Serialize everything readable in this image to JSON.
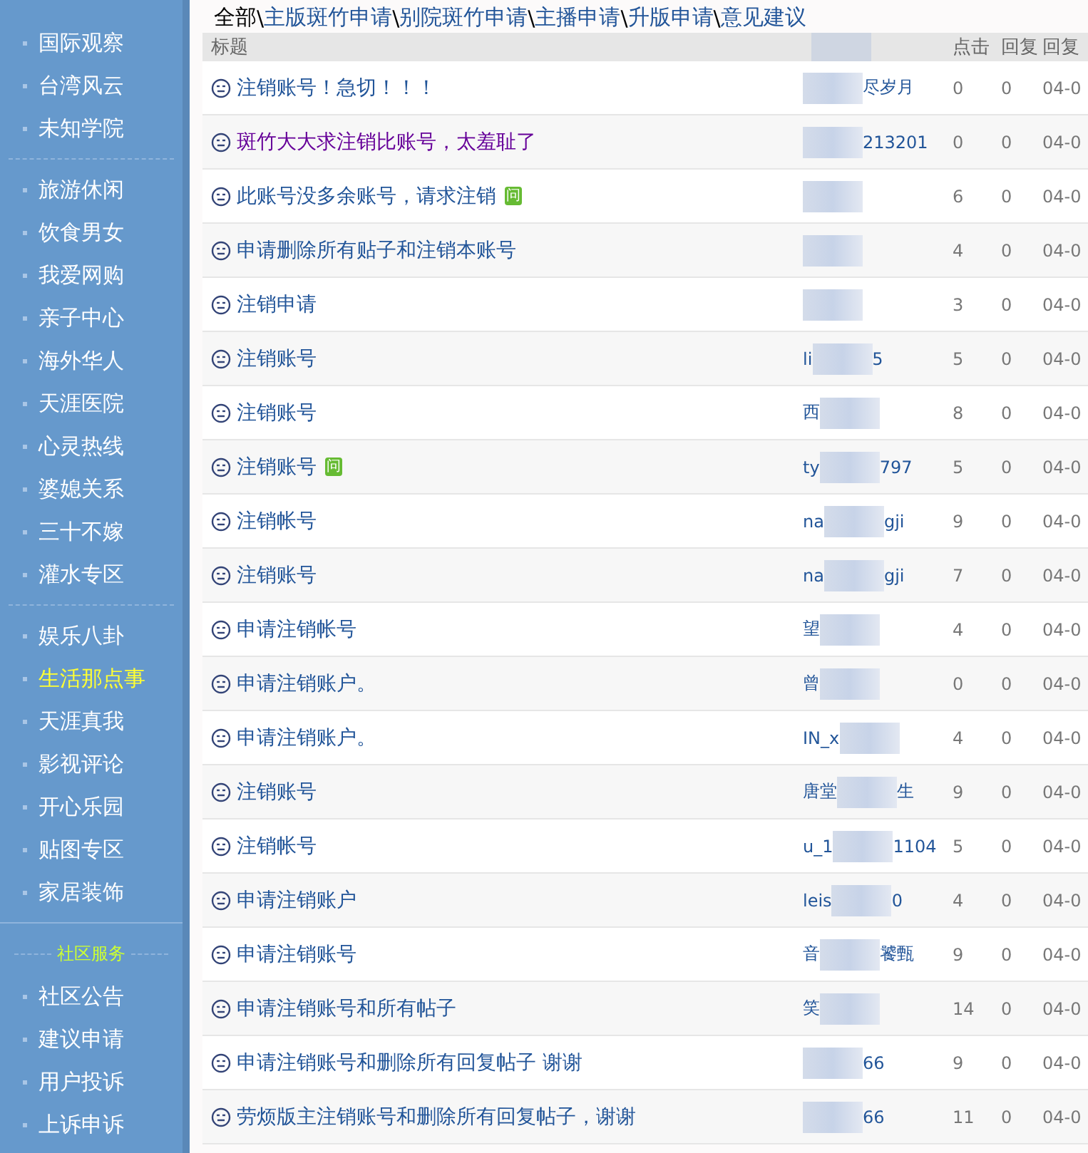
{
  "sidebar": {
    "groups": [
      {
        "kind": "links",
        "items": [
          {
            "label": "国际观察",
            "selected": false
          },
          {
            "label": "台湾风云",
            "selected": false
          },
          {
            "label": "未知学院",
            "selected": false
          }
        ]
      },
      {
        "kind": "links",
        "items": [
          {
            "label": "旅游休闲",
            "selected": false
          },
          {
            "label": "饮食男女",
            "selected": false
          },
          {
            "label": "我爱网购",
            "selected": false
          },
          {
            "label": "亲子中心",
            "selected": false
          },
          {
            "label": "海外华人",
            "selected": false
          },
          {
            "label": "天涯医院",
            "selected": false
          },
          {
            "label": "心灵热线",
            "selected": false
          },
          {
            "label": "婆媳关系",
            "selected": false
          },
          {
            "label": "三十不嫁",
            "selected": false
          },
          {
            "label": "灌水专区",
            "selected": false
          }
        ]
      },
      {
        "kind": "links",
        "items": [
          {
            "label": "娱乐八卦",
            "selected": false
          },
          {
            "label": "生活那点事",
            "selected": true
          },
          {
            "label": "天涯真我",
            "selected": false
          },
          {
            "label": "影视评论",
            "selected": false
          },
          {
            "label": "开心乐园",
            "selected": false
          },
          {
            "label": "贴图专区",
            "selected": false
          },
          {
            "label": "家居装饰",
            "selected": false
          }
        ]
      },
      {
        "kind": "section",
        "title": "社区服务",
        "items": [
          {
            "label": "社区公告",
            "selected": false
          },
          {
            "label": "建议申请",
            "selected": false
          },
          {
            "label": "用户投诉",
            "selected": false
          },
          {
            "label": "上诉申诉",
            "selected": false
          }
        ]
      }
    ]
  },
  "breadcrumb": {
    "separator": "\\",
    "items": [
      {
        "label": "全部",
        "selected": true
      },
      {
        "label": "主版斑竹申请",
        "selected": false
      },
      {
        "label": "别院斑竹申请",
        "selected": false
      },
      {
        "label": "主播申请",
        "selected": false
      },
      {
        "label": "升版申请",
        "selected": false
      },
      {
        "label": "意见建议",
        "selected": false
      }
    ]
  },
  "table": {
    "columns": [
      {
        "label": "标题"
      },
      {
        "kind": "blurred"
      },
      {
        "label": "点击"
      },
      {
        "label": "回复"
      },
      {
        "label": "回复"
      }
    ],
    "rows": [
      {
        "title": "注销账号！急切！！！",
        "visited": false,
        "badge": "",
        "author_start": "",
        "author_end": "尽岁月",
        "clicks": "0",
        "replies": "0",
        "date": "04-0"
      },
      {
        "title": "斑竹大大求注销比账号，太羞耻了",
        "visited": true,
        "badge": "",
        "author_start": "",
        "author_end": "213201",
        "clicks": "0",
        "replies": "0",
        "date": "04-0"
      },
      {
        "title": "此账号没多余账号，请求注销",
        "visited": false,
        "badge": "问",
        "author_start": "",
        "author_end": "",
        "clicks": "6",
        "replies": "0",
        "date": "04-0"
      },
      {
        "title": "申请删除所有贴子和注销本账号",
        "visited": false,
        "badge": "",
        "author_start": "",
        "author_end": "",
        "clicks": "4",
        "replies": "0",
        "date": "04-0"
      },
      {
        "title": "注销申请",
        "visited": false,
        "badge": "",
        "author_start": "",
        "author_end": "",
        "clicks": "3",
        "replies": "0",
        "date": "04-0"
      },
      {
        "title": "注销账号",
        "visited": false,
        "badge": "",
        "author_start": "li",
        "author_end": "5",
        "clicks": "5",
        "replies": "0",
        "date": "04-0"
      },
      {
        "title": "注销账号",
        "visited": false,
        "badge": "",
        "author_start": "西",
        "author_end": "",
        "clicks": "8",
        "replies": "0",
        "date": "04-0"
      },
      {
        "title": "注销账号",
        "visited": false,
        "badge": "问",
        "author_start": "ty",
        "author_end": "797",
        "clicks": "5",
        "replies": "0",
        "date": "04-0"
      },
      {
        "title": "注销帐号",
        "visited": false,
        "badge": "",
        "author_start": "na",
        "author_end": "gji",
        "clicks": "9",
        "replies": "0",
        "date": "04-0"
      },
      {
        "title": "注销账号",
        "visited": false,
        "badge": "",
        "author_start": "na",
        "author_end": "gji",
        "clicks": "7",
        "replies": "0",
        "date": "04-0"
      },
      {
        "title": "申请注销帐号",
        "visited": false,
        "badge": "",
        "author_start": "望",
        "author_end": "",
        "clicks": "4",
        "replies": "0",
        "date": "04-0"
      },
      {
        "title": "申请注销账户。",
        "visited": false,
        "badge": "",
        "author_start": "曾",
        "author_end": "",
        "clicks": "0",
        "replies": "0",
        "date": "04-0"
      },
      {
        "title": "申请注销账户。",
        "visited": false,
        "badge": "",
        "author_start": "IN_x",
        "author_end": "",
        "clicks": "4",
        "replies": "0",
        "date": "04-0"
      },
      {
        "title": "注销账号",
        "visited": false,
        "badge": "",
        "author_start": "唐堂",
        "author_end": "生",
        "clicks": "9",
        "replies": "0",
        "date": "04-0"
      },
      {
        "title": "注销帐号",
        "visited": false,
        "badge": "",
        "author_start": "u_1",
        "author_end": "1104",
        "clicks": "5",
        "replies": "0",
        "date": "04-0"
      },
      {
        "title": "申请注销账户",
        "visited": false,
        "badge": "",
        "author_start": "leis",
        "author_end": "0",
        "clicks": "4",
        "replies": "0",
        "date": "04-0"
      },
      {
        "title": "申请注销账号",
        "visited": false,
        "badge": "",
        "author_start": "音",
        "author_end": "饕甄",
        "clicks": "9",
        "replies": "0",
        "date": "04-0"
      },
      {
        "title": "申请注销账号和所有帖子",
        "visited": false,
        "badge": "",
        "author_start": "笑",
        "author_end": "",
        "clicks": "14",
        "replies": "0",
        "date": "04-0"
      },
      {
        "title": "申请注销账号和删除所有回复帖子 谢谢",
        "visited": false,
        "badge": "",
        "author_start": "",
        "author_end": "66",
        "clicks": "9",
        "replies": "0",
        "date": "04-0"
      },
      {
        "title": "劳烦版主注销账号和删除所有回复帖子，谢谢",
        "visited": false,
        "badge": "",
        "author_start": "",
        "author_end": "66",
        "clicks": "11",
        "replies": "0",
        "date": "04-0"
      }
    ]
  }
}
